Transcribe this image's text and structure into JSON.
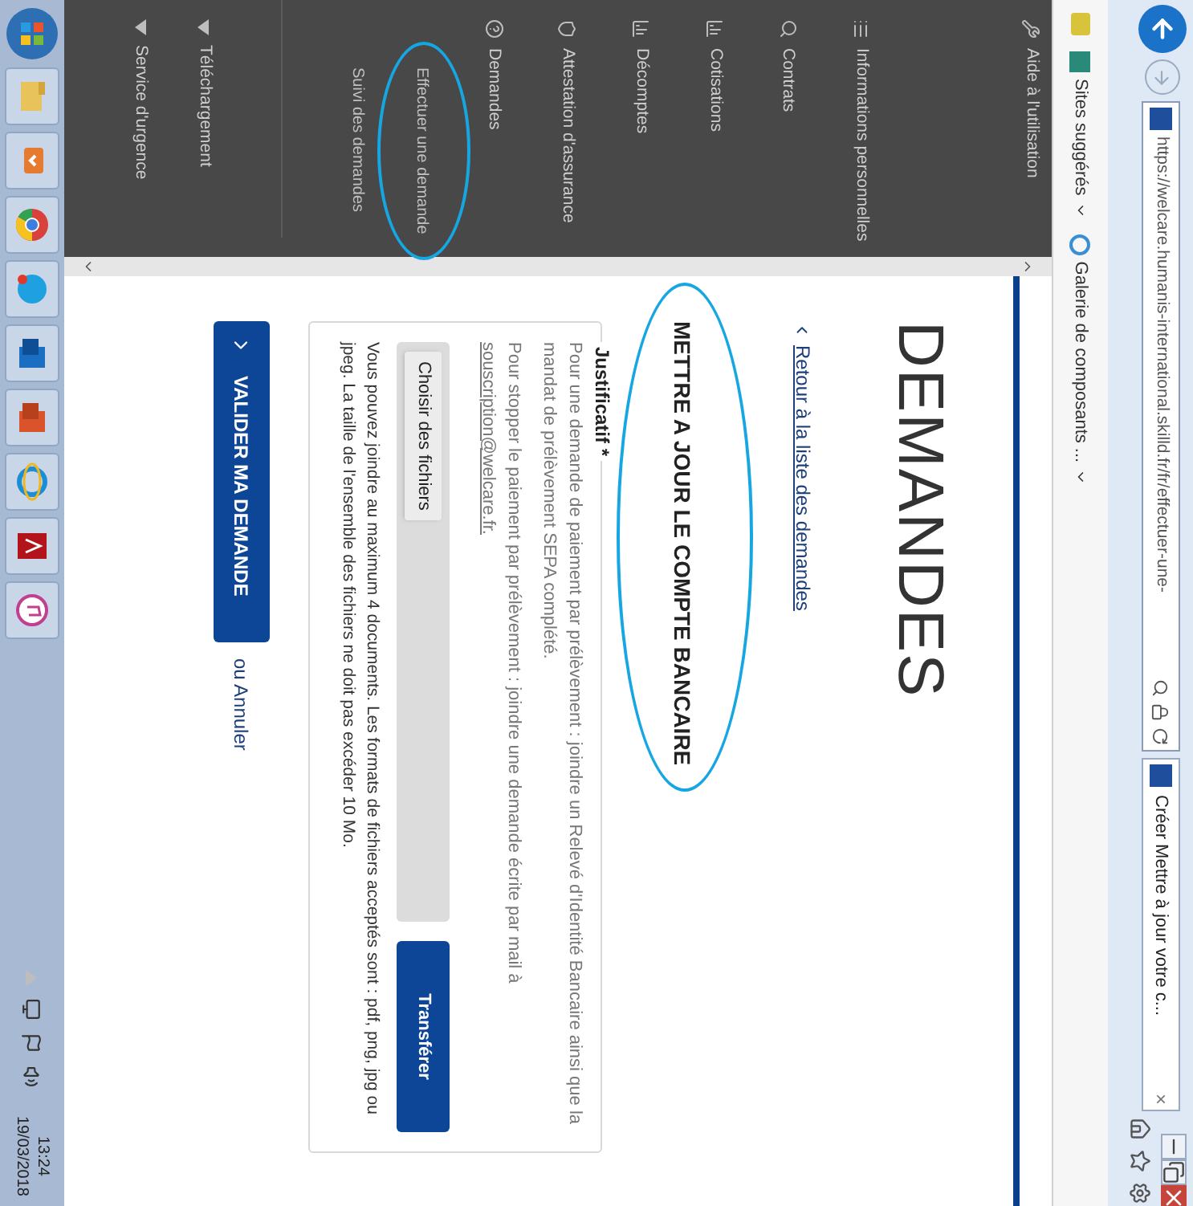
{
  "browser": {
    "url": "https://welcare.humanis-international.skilld.fr/fr/effectuer-une-",
    "tab_title": "Créer Mettre à jour votre c...",
    "tab_close": "×",
    "favorites": [
      {
        "label": "Sites suggérés"
      },
      {
        "label": "Galerie de composants ..."
      }
    ]
  },
  "sidebar": {
    "items": [
      {
        "label": "Aide à l'utilisation",
        "kind": "link"
      },
      {
        "label": "Informations personnelles",
        "kind": "link"
      },
      {
        "label": "Contrats",
        "kind": "link"
      },
      {
        "label": "Cotisations",
        "kind": "link"
      },
      {
        "label": "Décomptes",
        "kind": "link"
      },
      {
        "label": "Attestation d'assurance",
        "kind": "link"
      },
      {
        "label": "Demandes",
        "kind": "link",
        "children": [
          {
            "label": "Effectuer une demande"
          },
          {
            "label": "Suivi des demandes"
          }
        ]
      },
      {
        "label": "Téléchargement",
        "kind": "dropdown",
        "expanded": false
      },
      {
        "label": "Service d'urgence",
        "kind": "dropdown",
        "expanded": false
      }
    ]
  },
  "page": {
    "title": "DEMANDES",
    "back_link": "Retour à la liste des demandes",
    "heading": "METTRE A JOUR LE COMPTE BANCAIRE",
    "fieldset": {
      "legend": "Justificatif",
      "required_mark": "*",
      "paragraphs": [
        {
          "text": "Pour une demande de paiement par prélèvement : joindre un Relevé d'Identité Bancaire ainsi que la mandat de prélèvement SEPA complété."
        },
        {
          "text": "Pour stopper le paiement par prélèvement : joindre une demande écrite par mail à",
          "link": "souscription@welcare.fr."
        }
      ],
      "file_button": "Choisir des fichiers",
      "upload_button": "Transférer",
      "note": "Vous pouvez joindre au maximum 4 documents. Les formats de fichiers acceptés sont : pdf, png, jpg ou jpeg. La taille de l'ensemble des fichiers ne doit pas excéder 10 Mo."
    },
    "submit": "VALIDER MA DEMANDE",
    "cancel_prefix": "ou",
    "cancel": "Annuler"
  },
  "taskbar": {
    "time": "13:24",
    "date": "19/03/2018"
  }
}
